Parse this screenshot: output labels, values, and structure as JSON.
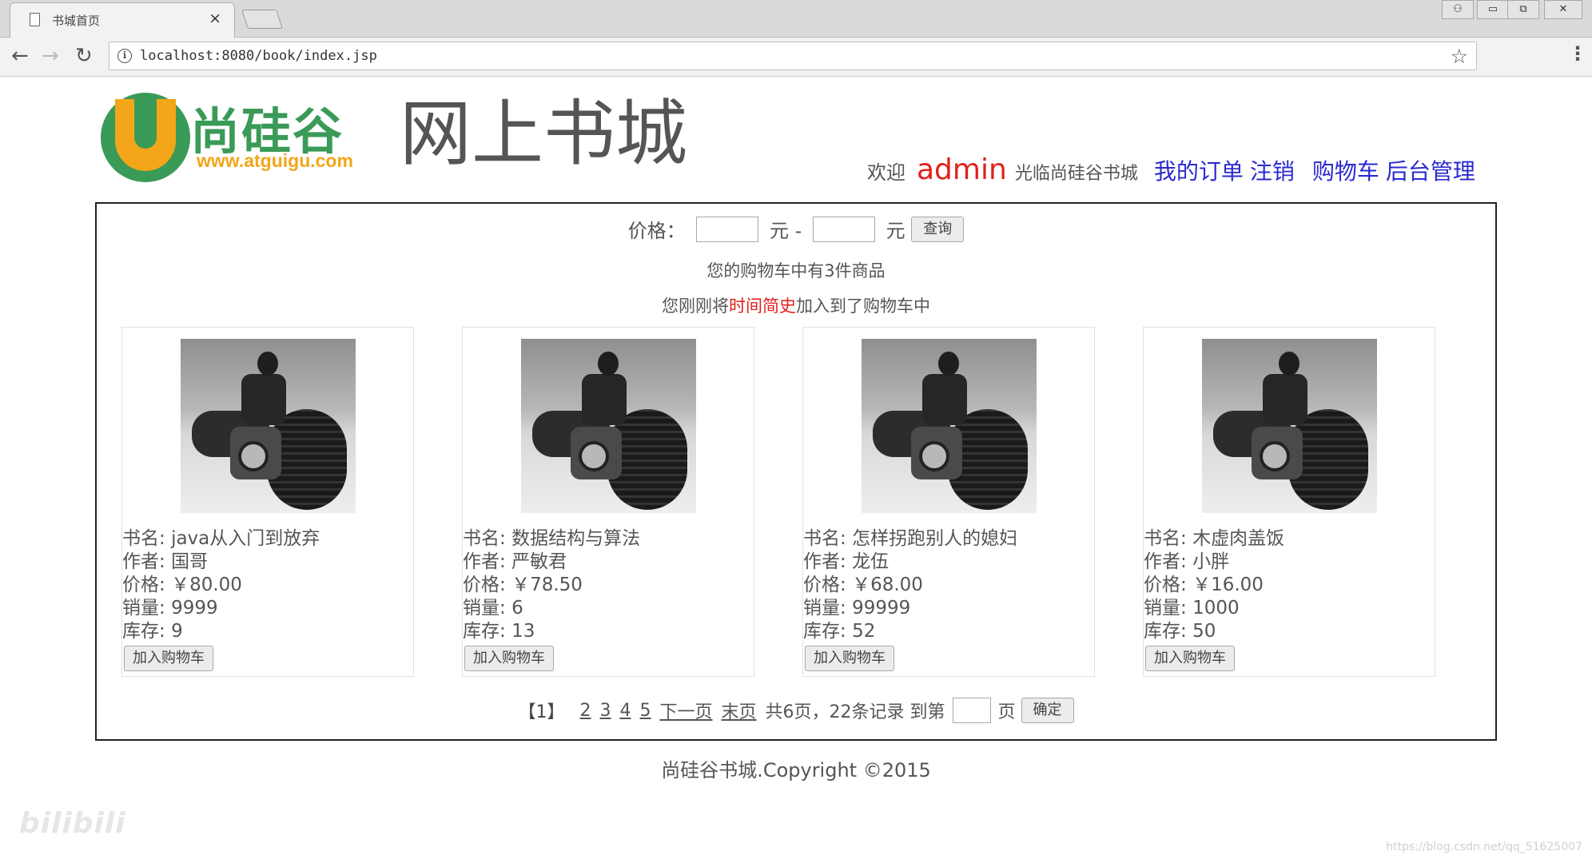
{
  "browser": {
    "tab_title": "书城首页",
    "tab_close": "×",
    "url": "localhost:8080/book/index.jsp",
    "nav_back": "←",
    "nav_forward": "→",
    "nav_reload": "↻",
    "info_glyph": "i",
    "star_glyph": "☆",
    "menu_glyph": "⋮",
    "win_user": "⚇",
    "win_min": "▭",
    "win_max": "⧉",
    "win_close": "✕"
  },
  "header": {
    "logo_cn": "尚硅谷",
    "logo_url": "www.atguigu.com",
    "site_title": "网上书城",
    "welcome": "欢迎",
    "username": "admin",
    "greeting": "光临尚硅谷书城",
    "links": {
      "orders": "我的订单",
      "logout": "注销",
      "cart": "购物车",
      "admin": "后台管理"
    }
  },
  "search": {
    "price_label": "价格：",
    "unit_min": "元 -",
    "unit_max": "元",
    "min_value": "",
    "max_value": "",
    "button": "查询"
  },
  "cart_info": "您的购物车中有3件商品",
  "last_added": {
    "prefix": "您刚刚将",
    "book": "时间简史",
    "suffix": "加入到了购物车中"
  },
  "labels": {
    "name": "书名: ",
    "author": "作者: ",
    "price": "价格: ",
    "sales": "销量: ",
    "stock": "库存: ",
    "add_to_cart": "加入购物车"
  },
  "books": [
    {
      "name": "java从入门到放弃",
      "author": "国哥",
      "price": "￥80.00",
      "sales": "9999",
      "stock": "9"
    },
    {
      "name": "数据结构与算法",
      "author": "严敏君",
      "price": "￥78.50",
      "sales": "6",
      "stock": "13"
    },
    {
      "name": "怎样拐跑别人的媳妇",
      "author": "龙伍",
      "price": "￥68.00",
      "sales": "99999",
      "stock": "52"
    },
    {
      "name": "木虚肉盖饭",
      "author": "小胖",
      "price": "￥16.00",
      "sales": "1000",
      "stock": "50"
    }
  ],
  "pager": {
    "current": "【1】",
    "pages": [
      "2",
      "3",
      "4",
      "5"
    ],
    "next": "下一页",
    "last": "末页",
    "total": "共6页，22条记录 到第",
    "page_unit": "页",
    "goto_value": "",
    "confirm": "确定"
  },
  "footer": "尚硅谷书城.Copyright ©2015",
  "watermarks": {
    "left": "bilibili",
    "right": "https://blog.csdn.net/qq_51625007"
  }
}
